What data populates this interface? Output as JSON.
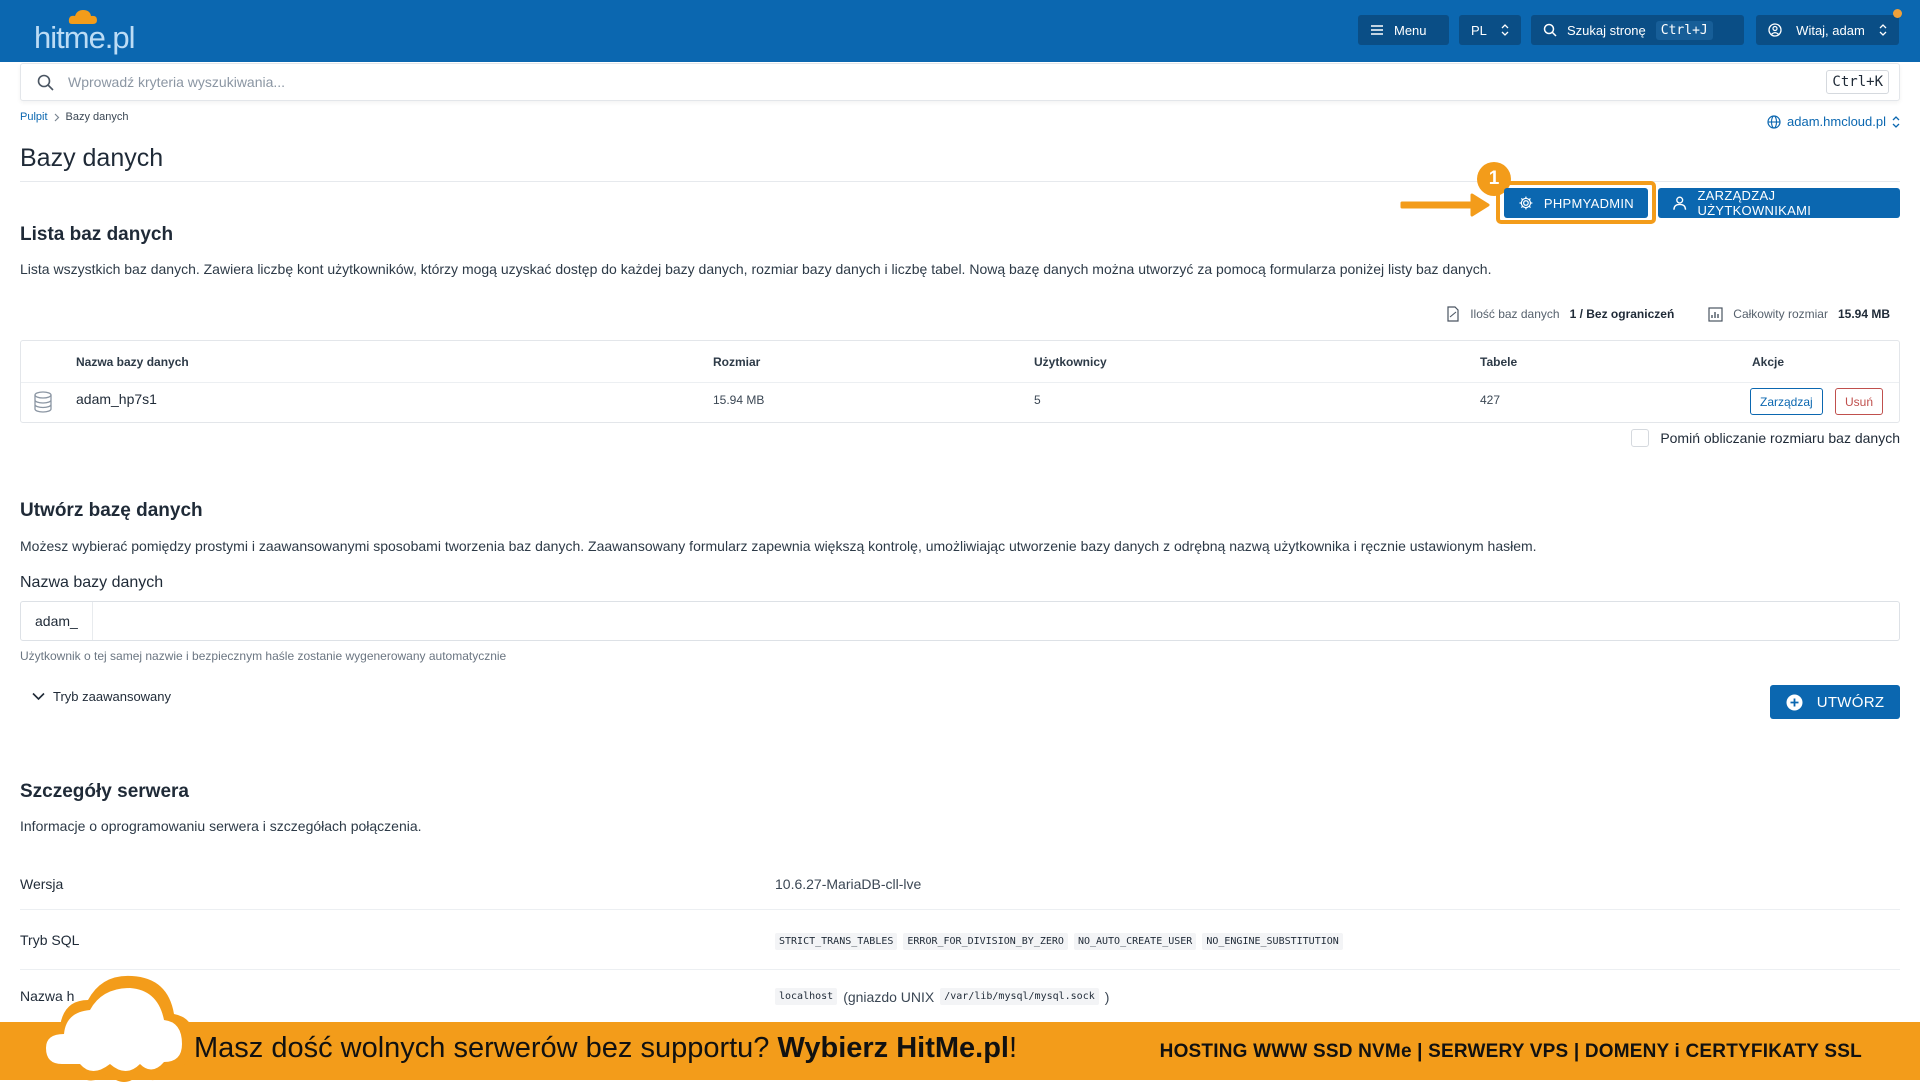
{
  "brand": {
    "logo_text": "hitme.pl"
  },
  "topbar": {
    "menu_label": "Menu",
    "lang_label": "PL",
    "search_label": "Szukaj stronę",
    "search_shortcut": "Ctrl+J",
    "user_label": "Witaj, adam"
  },
  "search": {
    "placeholder": "Wprowadź kryteria wyszukiwania...",
    "shortcut": "Ctrl+K"
  },
  "breadcrumb": {
    "root": "Pulpit",
    "current": "Bazy danych"
  },
  "domain_selector": {
    "label": "adam.hmcloud.pl"
  },
  "page": {
    "title": "Bazy danych"
  },
  "annotation": {
    "step": "1"
  },
  "actions": {
    "phpmyadmin": "PHPMYADMIN",
    "manage_users": "ZARZĄDZAJ UŻYTKOWNIKAMI"
  },
  "db_list": {
    "title": "Lista baz danych",
    "description": "Lista wszystkich baz danych. Zawiera liczbę kont użytkowników, którzy mogą uzyskać dostęp do każdej bazy danych, rozmiar bazy danych i liczbę tabel. Nową bazę danych można utworzyć za pomocą formularza poniżej listy baz danych.",
    "count_label": "Ilość baz danych",
    "count_value": "1 / Bez ograniczeń",
    "size_label": "Całkowity rozmiar",
    "size_value": "15.94 MB",
    "columns": {
      "name": "Nazwa bazy danych",
      "size": "Rozmiar",
      "users": "Użytkownicy",
      "tables": "Tabele",
      "actions": "Akcje"
    },
    "rows": [
      {
        "name": "adam_hp7s1",
        "size": "15.94 MB",
        "users": "5",
        "tables": "427",
        "manage": "Zarządzaj",
        "delete": "Usuń"
      }
    ],
    "skip_size_label": "Pomiń obliczanie rozmiaru baz danych"
  },
  "create_db": {
    "title": "Utwórz bazę danych",
    "description": "Możesz wybierać pomiędzy prostymi i zaawansowanymi sposobami tworzenia baz danych. Zaawansowany formularz zapewnia większą kontrolę, umożliwiając utworzenie bazy danych z odrębną nazwą użytkownika i ręcznie ustawionym hasłem.",
    "field_label": "Nazwa bazy danych",
    "prefix": "adam_",
    "hint": "Użytkownik o tej samej nazwie i bezpiecznym haśle zostanie wygenerowany automatycznie",
    "advanced_label": "Tryb zaawansowany",
    "submit_label": "UTWÓRZ"
  },
  "server": {
    "title": "Szczegóły serwera",
    "description": "Informacje o oprogramowaniu serwera i szczegółach połączenia.",
    "version_label": "Wersja",
    "version_value": "10.6.27-MariaDB-cll-lve",
    "sql_mode_label": "Tryb SQL",
    "sql_modes": [
      "STRICT_TRANS_TABLES",
      "ERROR_FOR_DIVISION_BY_ZERO",
      "NO_AUTO_CREATE_USER",
      "NO_ENGINE_SUBSTITUTION"
    ],
    "host_label": "Nazwa h",
    "host_value": "localhost",
    "host_socket_prefix": "(gniazdo UNIX",
    "host_socket_path": "/var/lib/mysql/mysql.sock",
    "host_socket_suffix": ")"
  },
  "banner": {
    "message": "Masz dość wolnych serwerów bez supportu?",
    "message_bold": "Wybierz HitMe.pl",
    "message_end": "!",
    "tagline": "HOSTING WWW SSD NVMe | SERWERY VPS | DOMENY i CERTYFIKATY SSL"
  },
  "colors": {
    "primary": "#0b67b0",
    "accent": "#f39c1a",
    "danger": "#c0504d"
  },
  "icons": {
    "menu": "hamburger-icon",
    "lang": "updown-chevron-icon",
    "search": "search-icon",
    "user": "user-circle-icon",
    "globe": "globe-icon",
    "phpmyadmin": "gear-icon",
    "manage_users": "user-icon",
    "db": "database-icon",
    "create": "plus-circle-icon",
    "count": "document-icon",
    "size": "chart-icon"
  }
}
